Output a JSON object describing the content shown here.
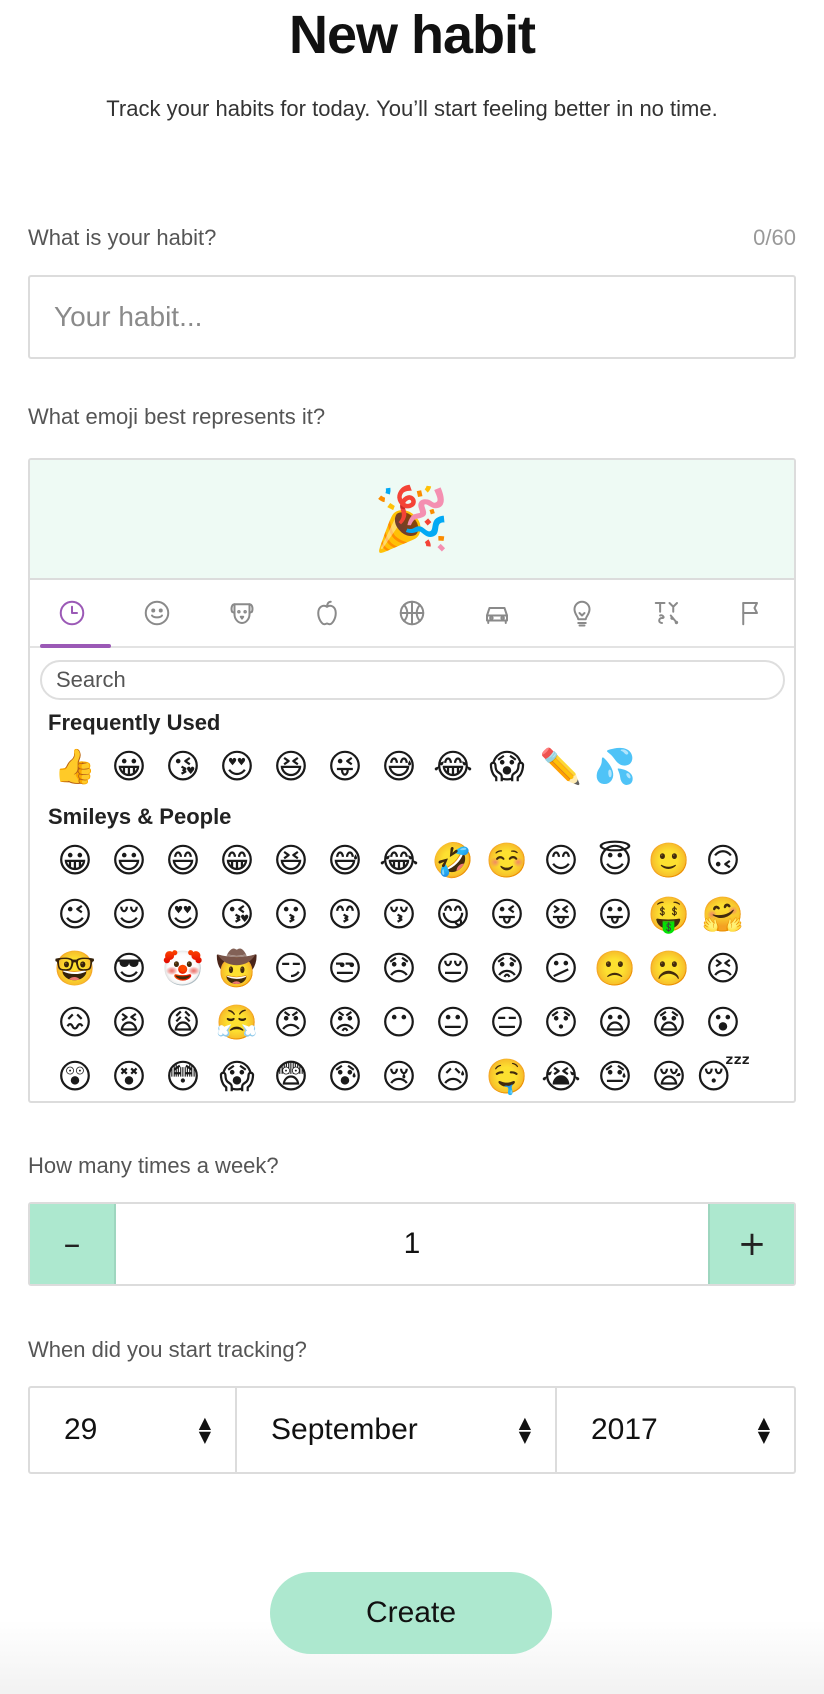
{
  "header": {
    "title": "New habit",
    "subtitle": "Track your habits for today. You’ll start feeling better in no time."
  },
  "habit": {
    "label": "What is your habit?",
    "counter": "0/60",
    "placeholder": "Your habit..."
  },
  "emoji_picker": {
    "label": "What emoji best represents it?",
    "selected": "🎉",
    "tabs": [
      "frequently-used",
      "smileys-people",
      "animals-nature",
      "food-drink",
      "activity",
      "travel-places",
      "objects",
      "symbols",
      "flags"
    ],
    "active_tab": "frequently-used",
    "search_placeholder": "Search",
    "sections": [
      {
        "title": "Frequently Used",
        "rows": [
          [
            "👍",
            "😀",
            "😘",
            "😍",
            "😆",
            "😜",
            "😅",
            "😂",
            "😱",
            "✏️",
            "💦"
          ]
        ]
      },
      {
        "title": "Smileys & People",
        "rows": [
          [
            "😀",
            "😃",
            "😄",
            "😁",
            "😆",
            "😅",
            "😂",
            "🤣",
            "☺️",
            "😊",
            "😇",
            "🙂",
            "🙃"
          ],
          [
            "😉",
            "😌",
            "😍",
            "😘",
            "😗",
            "😙",
            "😚",
            "😋",
            "😜",
            "😝",
            "😛",
            "🤑",
            "🤗"
          ],
          [
            "🤓",
            "😎",
            "🤡",
            "🤠",
            "😏",
            "😒",
            "😞",
            "😔",
            "😟",
            "😕",
            "🙁",
            "☹️",
            "😣"
          ],
          [
            "😖",
            "😫",
            "😩",
            "😤",
            "😠",
            "😡",
            "😶",
            "😐",
            "😑",
            "😯",
            "😦",
            "😧",
            "😮"
          ],
          [
            "😲",
            "😵",
            "😳",
            "😱",
            "😨",
            "😰",
            "😢",
            "😥",
            "🤤",
            "😭",
            "😓",
            "😪",
            "😴"
          ]
        ]
      }
    ]
  },
  "frequency": {
    "label": "How many times a week?",
    "minus": "–",
    "value": "1",
    "plus": "+"
  },
  "start_date": {
    "label": "When did you start tracking?",
    "day": "29",
    "month": "September",
    "year": "2017"
  },
  "submit": {
    "label": "Create"
  },
  "colors": {
    "accent": "#ade8cf",
    "preview_bg": "#eefaf4",
    "tab_active": "#9b59b6"
  }
}
